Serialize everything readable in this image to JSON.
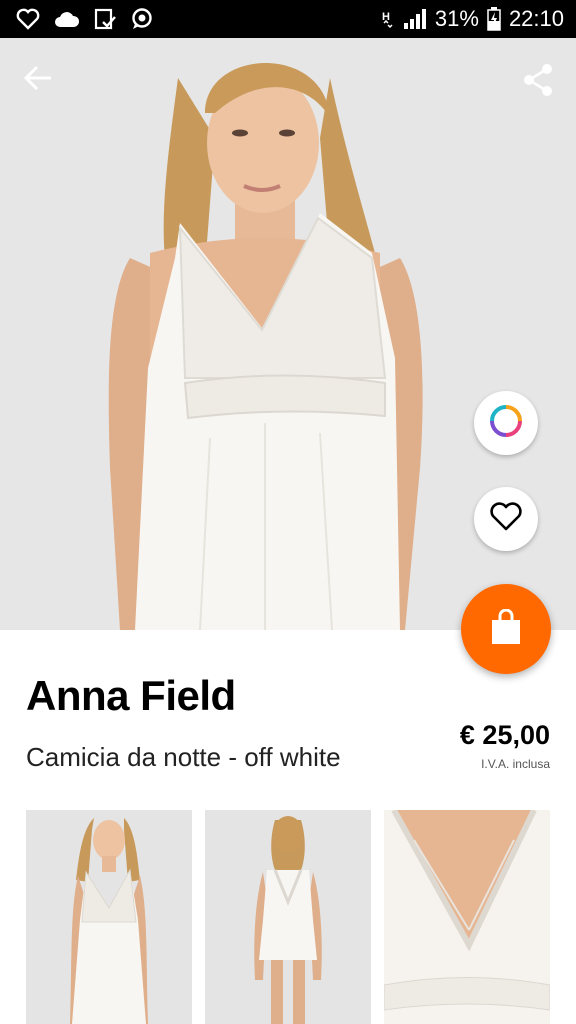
{
  "status_bar": {
    "icons_left": [
      "heart-icon",
      "cloud-icon",
      "clipboard-check-icon",
      "chat-icon"
    ],
    "battery": "31%",
    "time": "22:10"
  },
  "toolbar": {
    "back_icon": "arrow-left-icon",
    "share_icon": "share-icon"
  },
  "actions": {
    "color_icon": "color-ring-icon",
    "wishlist_icon": "heart-outline-icon",
    "cart_icon": "shopping-bag-icon",
    "cart_color": "#ff6900"
  },
  "product": {
    "brand": "Anna Field",
    "name": "Camicia da notte - off white",
    "price": "€ 25,00",
    "vat_note": "I.V.A. inclusa"
  },
  "thumbnails": [
    "front-view",
    "back-view",
    "detail-view"
  ]
}
